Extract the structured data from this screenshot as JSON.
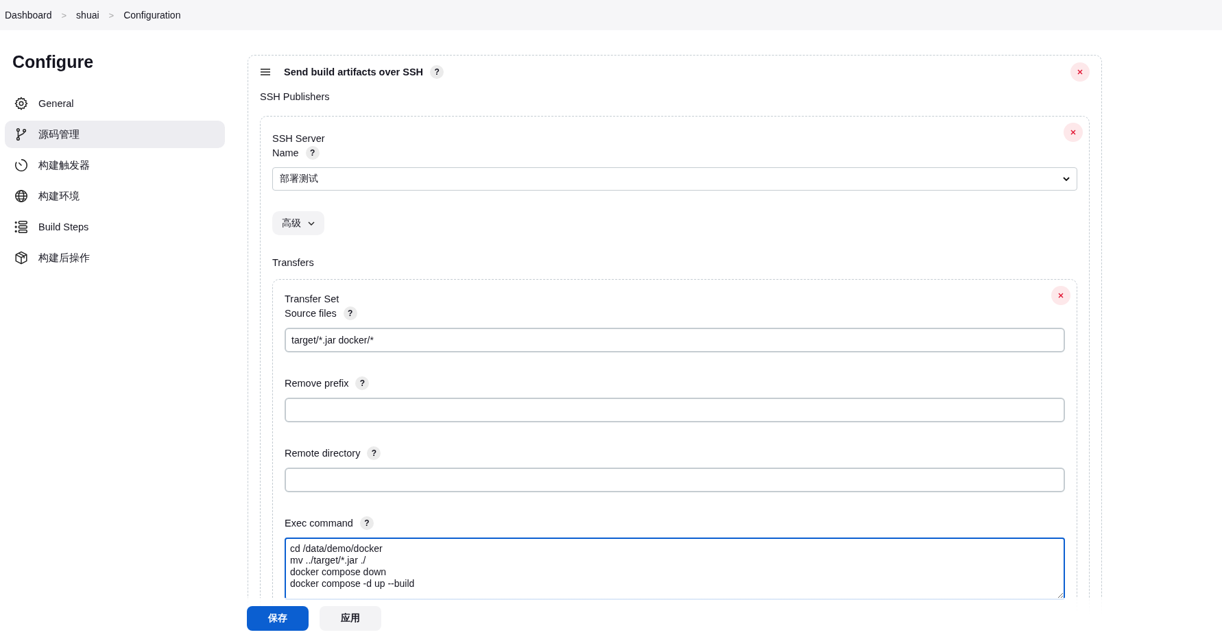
{
  "breadcrumbs": [
    {
      "label": "Dashboard",
      "separator": ">"
    },
    {
      "label": "shuai",
      "separator": ">"
    },
    {
      "label": "Configuration"
    }
  ],
  "sidebar": {
    "title": "Configure",
    "items": [
      {
        "label": "General",
        "kind": "gear",
        "selected": false
      },
      {
        "label": "源码管理",
        "kind": "branch",
        "selected": true
      },
      {
        "label": "构建触发器",
        "kind": "timer",
        "selected": false
      },
      {
        "label": "构建环境",
        "kind": "globe",
        "selected": false
      },
      {
        "label": "Build Steps",
        "kind": "steps",
        "selected": false
      },
      {
        "label": "构建后操作",
        "kind": "package",
        "selected": false
      }
    ]
  },
  "publisher": {
    "title": "Send build artifacts over SSH",
    "help": "?",
    "section_label": "SSH Publishers",
    "server": {
      "heading": "SSH Server",
      "name_label": "Name",
      "help": "?",
      "name_value": "部署测试",
      "advanced_button": "高级",
      "transfers_label": "Transfers",
      "transfer_set": {
        "heading": "Transfer Set",
        "fields": [
          {
            "label": "Source files",
            "help": "?",
            "kind": "input",
            "value": "target/*.jar docker/*",
            "focused": false
          },
          {
            "label": "Remove prefix",
            "help": "?",
            "kind": "input",
            "focused": false
          },
          {
            "label": "Remote directory",
            "help": "?",
            "kind": "input",
            "focused": false
          },
          {
            "label": "Exec command",
            "help": "?",
            "kind": "textarea",
            "value": "cd /data/demo/docker\nmv ../target/*.jar ./\ndocker compose down\ndocker compose -d up --build",
            "focused": true
          }
        ]
      }
    }
  },
  "buttons": [
    {
      "label": "保存",
      "kind": "primary"
    },
    {
      "label": "应用",
      "kind": "secondary"
    }
  ]
}
